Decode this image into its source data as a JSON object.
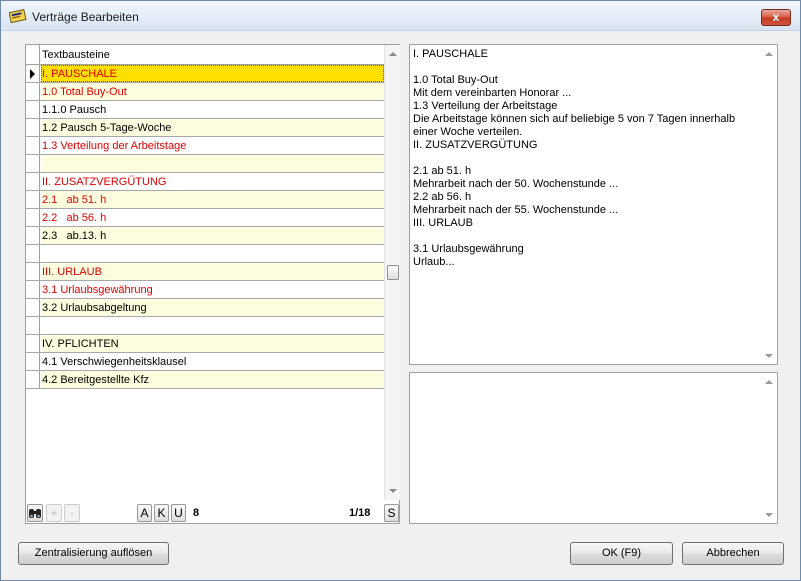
{
  "window": {
    "title": "Verträge Bearbeiten",
    "close_label": "x"
  },
  "grid": {
    "header": "Textbausteine",
    "rows": [
      {
        "text": "I. PAUSCHALE",
        "color": "red",
        "bg": "sel",
        "current": true
      },
      {
        "text": "1.0 Total Buy-Out",
        "color": "red",
        "bg": "alt"
      },
      {
        "text": "1.1.0 Pausch",
        "color": "blk",
        "bg": "plain"
      },
      {
        "text": "1.2 Pausch 5-Tage-Woche",
        "color": "blk",
        "bg": "alt"
      },
      {
        "text": "1.3 Verteilung der Arbeitstage",
        "color": "red",
        "bg": "plain"
      },
      {
        "text": "",
        "color": "blk",
        "bg": "alt"
      },
      {
        "text": "II. ZUSATZVERGÜTUNG",
        "color": "red",
        "bg": "plain"
      },
      {
        "text": "2.1   ab 51. h",
        "color": "red",
        "bg": "alt"
      },
      {
        "text": "2.2   ab 56. h",
        "color": "red",
        "bg": "plain"
      },
      {
        "text": "2.3   ab.13. h",
        "color": "blk",
        "bg": "alt"
      },
      {
        "text": "",
        "color": "blk",
        "bg": "plain"
      },
      {
        "text": "III. URLAUB",
        "color": "red",
        "bg": "alt"
      },
      {
        "text": "3.1 Urlaubsgewährung",
        "color": "red",
        "bg": "plain"
      },
      {
        "text": "3.2 Urlaubsabgeltung",
        "color": "blk",
        "bg": "alt"
      },
      {
        "text": "",
        "color": "blk",
        "bg": "plain"
      },
      {
        "text": "IV. PFLICHTEN",
        "color": "blk",
        "bg": "alt"
      },
      {
        "text": "4.1 Verschwiegenheitsklausel",
        "color": "blk",
        "bg": "plain"
      },
      {
        "text": "4.2 Bereitgestellte Kfz",
        "color": "blk",
        "bg": "alt"
      }
    ],
    "scroll_fraction": 0.5
  },
  "toolbar": {
    "add_label": "+",
    "remove_label": "-",
    "a_label": "A",
    "k_label": "K",
    "u_label": "U",
    "count": "8",
    "position": "1/18",
    "s_label": "S"
  },
  "preview": {
    "text": "I. PAUSCHALE\n\n1.0 Total Buy-Out\nMit dem vereinbarten Honorar ...\n1.3 Verteilung der Arbeitstage\nDie Arbeitstage können sich auf beliebige 5 von 7 Tagen innerhalb einer Woche verteilen.\nII. ZUSATZVERGÜTUNG\n\n2.1   ab 51. h\nMehrarbeit nach der 50. Wochenstunde ...\n2.2   ab 56. h\nMehrarbeit nach der 55. Wochenstunde ...\nIII. URLAUB\n\n3.1 Urlaubsgewährung\nUrlaub..."
  },
  "detail": {
    "text": ""
  },
  "footer": {
    "dissolve_label": "Zentralisierung auflösen",
    "ok_label": "OK (F9)",
    "cancel_label": "Abbrechen"
  },
  "icons": {
    "app": "contract-icon",
    "find": "binoculars-icon"
  }
}
